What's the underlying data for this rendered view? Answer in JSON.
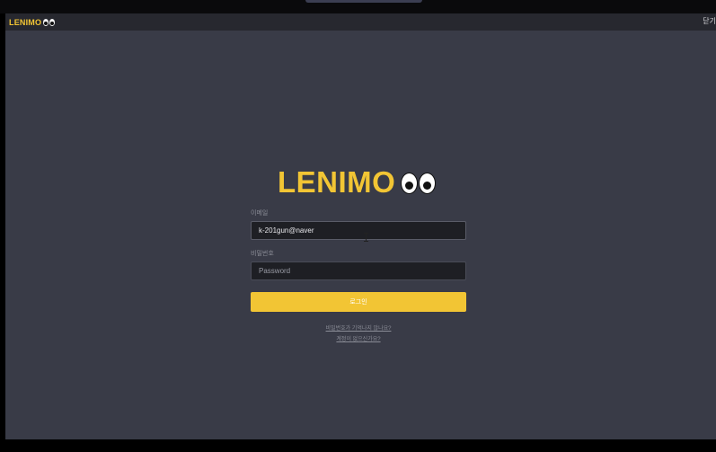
{
  "topbar": {
    "brand": "LENIMO",
    "close_label": "닫기"
  },
  "hero": {
    "brand": "LENIMO"
  },
  "form": {
    "email_label": "이메일",
    "email_value": "k-201gun@naver",
    "password_label": "비밀번호",
    "password_placeholder": "Password",
    "login_label": "로그인",
    "forgot_password_link": "비밀번호가 기억나지 않나요?",
    "signup_link": "계정이 없으신가요?"
  },
  "colors": {
    "accent": "#f2c534",
    "background": "#393b47",
    "topbar": "#27282f",
    "input_background": "#1e1f24"
  },
  "icons": {
    "logo_mark": "eyes-icon",
    "cursor": "text-cursor-icon"
  }
}
